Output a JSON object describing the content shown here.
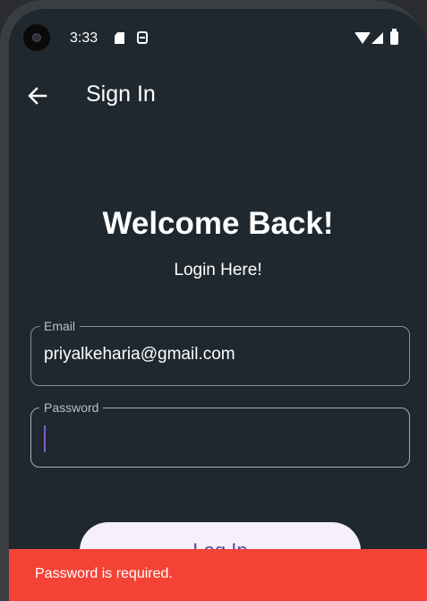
{
  "status_bar": {
    "time": "3:33",
    "icons": [
      "sd-card-icon",
      "sim-icon",
      "wifi-icon",
      "signal-icon",
      "battery-icon"
    ]
  },
  "app_bar": {
    "title": "Sign In",
    "back_icon": "arrow-left-icon"
  },
  "content": {
    "heading": "Welcome Back!",
    "subheading": "Login Here!"
  },
  "form": {
    "email": {
      "label": "Email",
      "value": "priyalkeharia@gmail.com"
    },
    "password": {
      "label": "Password",
      "value": ""
    },
    "login_label": "Log In"
  },
  "snackbar": {
    "message": "Password is required."
  },
  "colors": {
    "background": "#1f282f",
    "accent": "#7b5fd0",
    "error": "#f44336",
    "button_bg": "#f6f0fa",
    "button_text": "#5a47a3"
  }
}
